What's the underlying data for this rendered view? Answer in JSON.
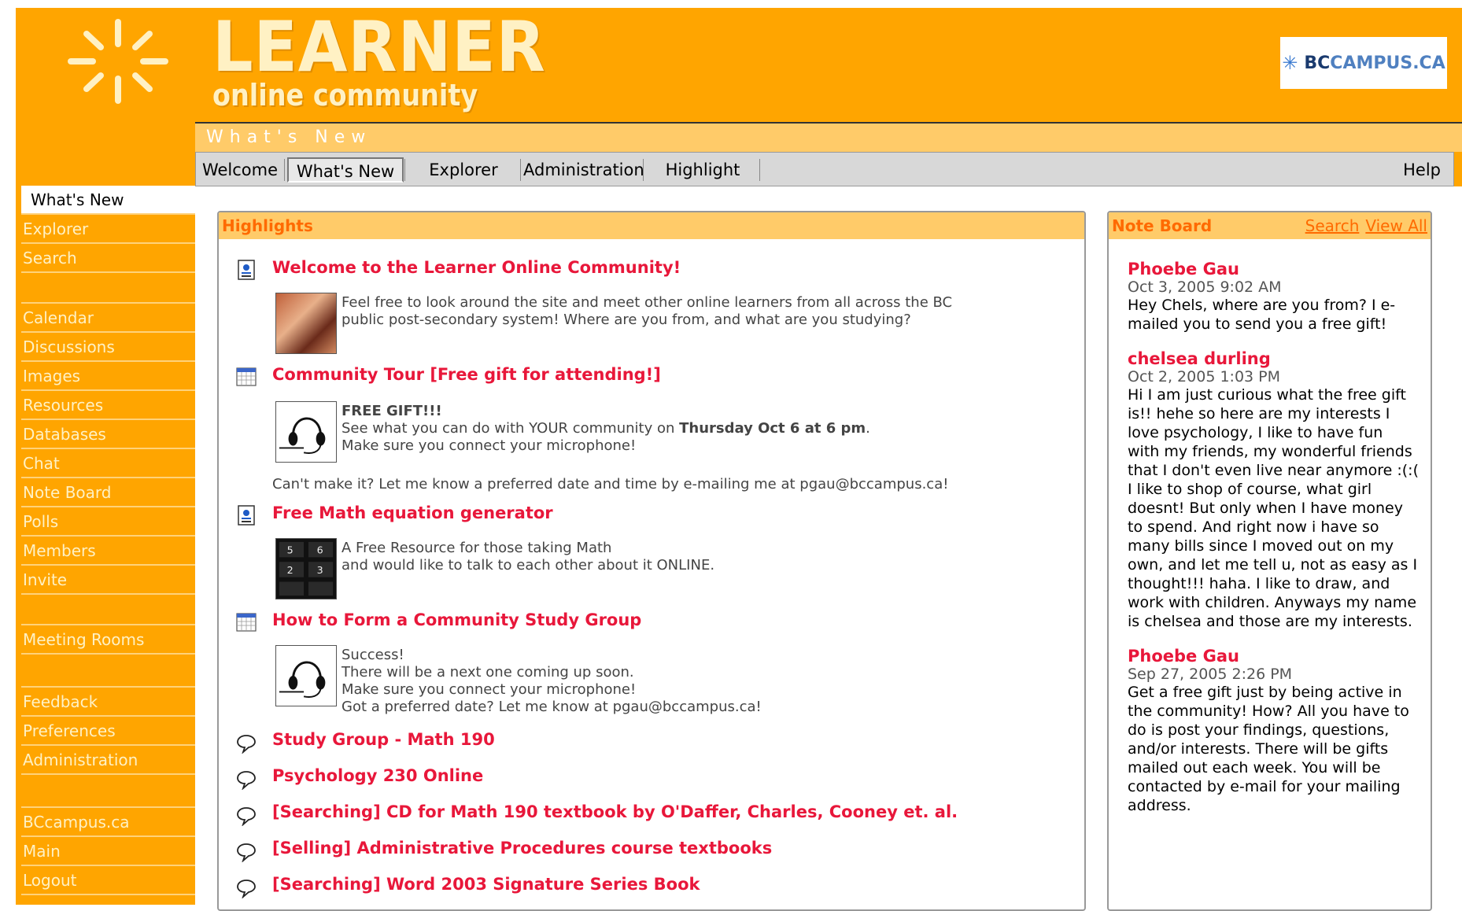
{
  "brand": {
    "title": "LEARNER",
    "subtitle": "online community",
    "partner_prefix": "BC",
    "partner_suffix": "CAMPUS.CA"
  },
  "section_title": "What's New",
  "tabs": [
    {
      "label": "Welcome"
    },
    {
      "label": "What's New"
    },
    {
      "label": "Explorer"
    },
    {
      "label": "Administration"
    },
    {
      "label": "Highlight"
    }
  ],
  "help_label": "Help",
  "sidebar": {
    "group1": [
      "What's New",
      "Explorer",
      "Search"
    ],
    "group2": [
      "Calendar",
      "Discussions",
      "Images",
      "Resources",
      "Databases",
      "Chat",
      "Note Board",
      "Polls",
      "Members",
      "Invite"
    ],
    "group3": [
      "Meeting Rooms"
    ],
    "group4": [
      "Feedback",
      "Preferences",
      "Administration"
    ],
    "group5": [
      "BCcampus.ca",
      "Main",
      "Logout"
    ]
  },
  "highlights": {
    "heading": "Highlights",
    "items": [
      {
        "title": "Welcome to the Learner Online Community!",
        "icon": "document-icon",
        "lines": [
          "Feel free to look around the site and meet other online learners from all across the BC",
          "public post-secondary system! Where are you from, and what are you studying?"
        ]
      },
      {
        "title": "Community Tour [Free gift for attending!]",
        "icon": "calendar-icon",
        "bold_line": "FREE GIFT!!!",
        "line2_pre": "See what you can do with YOUR community on ",
        "line2_bold": "Thursday Oct 6 at 6 pm",
        "line2_post": ".",
        "line3": "Make sure you connect your microphone!",
        "footer": "Can't make it? Let me know a preferred date and time by e-mailing me at pgau@bccampus.ca!"
      },
      {
        "title": "Free Math equation generator",
        "icon": "document-icon",
        "lines": [
          "A Free Resource for those taking Math",
          "and would like to talk to each other about it ONLINE."
        ]
      },
      {
        "title": "How to Form a Community Study Group",
        "icon": "calendar-icon",
        "lines": [
          "Success!",
          "There will be a next one coming up soon.",
          "Make sure you connect your microphone!",
          "Got a preferred date? Let me know at pgau@bccampus.ca!"
        ]
      },
      {
        "title": "Study Group - Math 190",
        "icon": "discussion-icon"
      },
      {
        "title": "Psychology 230 Online",
        "icon": "discussion-icon"
      },
      {
        "title": "[Searching] CD for Math 190 textbook by O'Daffer, Charles, Cooney et. al.",
        "icon": "discussion-icon"
      },
      {
        "title": "[Selling] Administrative Procedures course textbooks",
        "icon": "discussion-icon"
      },
      {
        "title": "[Searching] Word 2003 Signature Series Book",
        "icon": "discussion-icon"
      }
    ]
  },
  "noteboard": {
    "heading": "Note Board",
    "search_label": "Search",
    "viewall_label": "View All",
    "notes": [
      {
        "author": "Phoebe Gau",
        "date": "Oct 3, 2005 9:02 AM",
        "text": "Hey Chels, where are you from? I e-mailed you to send you a free gift!"
      },
      {
        "author": "chelsea durling",
        "date": "Oct 2, 2005 1:03 PM",
        "text": "Hi I am just curious what the free gift is!! hehe so here are my interests I love psychology, I like to have fun with my friends, my wonderful friends that I don't even live near anymore :(:( I like to shop of course, what girl doesnt! But only when I have money to spend. And right now i have so many bills since I moved out on my own, and let me tell u, not as easy as I thought!!! haha. I like to draw, and work with children. Anyways my name is chelsea and those are my interests."
      },
      {
        "author": "Phoebe Gau",
        "date": "Sep 27, 2005 2:26 PM",
        "text": "Get a free gift just by being active in the community! How? All you have to do is post your findings, questions, and/or interests. There will be gifts mailed out each week. You will be contacted by e-mail for your mailing address."
      }
    ]
  }
}
